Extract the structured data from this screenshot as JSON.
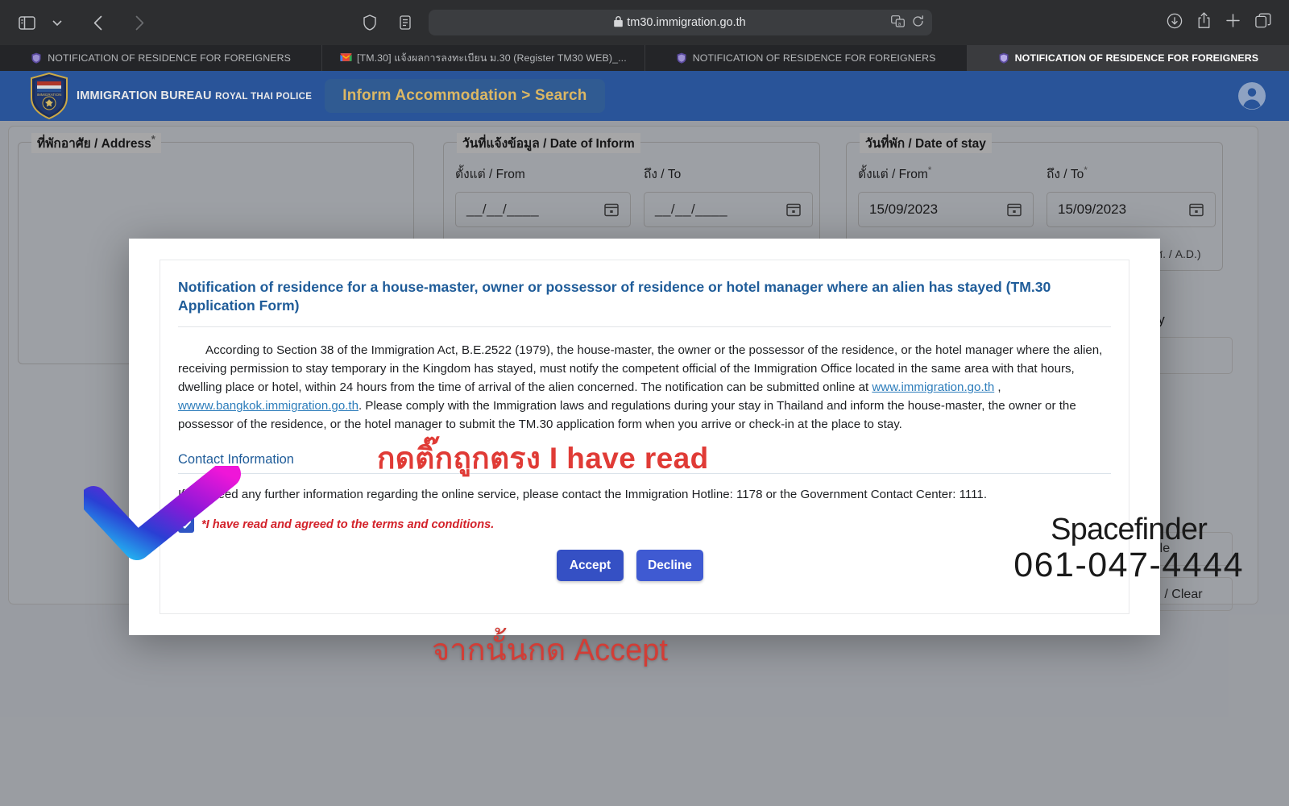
{
  "browser": {
    "url": "tm30.immigration.go.th",
    "icons": {
      "sidebar": "sidebar-icon",
      "sidebar_chevron": "chevron-down-icon",
      "back": "back-arrow-icon",
      "forward": "forward-arrow-icon",
      "shield": "shield-privacy-icon",
      "reader": "reader-view-icon",
      "lock": "lock-icon",
      "translate": "translate-icon",
      "reload": "reload-icon",
      "download": "download-icon",
      "share": "share-icon",
      "newtab": "plus-icon",
      "tabs": "tab-overview-icon"
    },
    "tabs": [
      {
        "title": "NOTIFICATION OF RESIDENCE FOR FOREIGNERS",
        "favicon": "immigration-shield-icon",
        "active": false
      },
      {
        "title": "[TM.30] แจ้งผลการลงทะเบียน ม.30 (Register TM30 WEB)_...",
        "favicon": "gmail-icon",
        "active": false
      },
      {
        "title": "NOTIFICATION OF RESIDENCE FOR FOREIGNERS",
        "favicon": "immigration-shield-icon",
        "active": false
      },
      {
        "title": "NOTIFICATION OF RESIDENCE FOR FOREIGNERS",
        "favicon": "immigration-shield-icon",
        "active": true
      }
    ]
  },
  "appbar": {
    "brand_line1": "IMMIGRATION BUREAU",
    "brand_line2": "ROYAL THAI POLICE",
    "nav_pill": "Inform Accommodation > Search",
    "accent_bg": "#2b5ba6",
    "pill_bg": "#33639f",
    "pill_text_color": "#f1c96b"
  },
  "form": {
    "address": {
      "legend": "ที่พักอาศัย / Address",
      "required": true
    },
    "date_of_inform": {
      "legend": "วันที่แจ้งข้อมูล / Date of Inform",
      "from_label": "ตั้งแต่ / From",
      "to_label": "ถึง / To",
      "from_value": "__/__/____",
      "to_value": "__/__/____"
    },
    "date_of_stay": {
      "legend": "วันที่พัก / Date of stay",
      "from_label": "ตั้งแต่ / From",
      "to_label": "ถึง / To",
      "from_value": "15/09/2023",
      "to_value": "15/09/2023",
      "from_required": true,
      "to_required": true,
      "hint": "ค.ศ. / A.D.)"
    },
    "nationality_label": "onality",
    "buttons": {
      "file": "e File",
      "clear": "้าจอ / Clear"
    }
  },
  "modal": {
    "title": "Notification of residence for a house-master, owner or possessor of residence or hotel manager where an alien has stayed (TM.30 Application Form)",
    "paragraph_1a": "According to Section 38 of the Immigration Act, B.E.2522 (1979), the house-master, the owner or the possessor of the residence, or the hotel manager where the alien, receiving permission to stay temporary in the Kingdom has stayed, must notify the competent official of the Immigration Office located in the same area with that hours, dwelling place or hotel, within 24 hours from the time of arrival of the alien concerned. The notification can be submitted online at ",
    "link_1": "www.immigration.go.th",
    "paragraph_1b": " , ",
    "link_2": "wwww.bangkok.immigration.go.th",
    "paragraph_1c": ". Please comply with the Immigration laws and regulations during your stay in Thailand and inform the house-master, the owner or the possessor of the residence, or the hotel manager to submit the TM.30 application form when you arrive or check-in at the place to stay.",
    "contact_heading": "Contact Information",
    "contact_text": "If you need any further information regarding the online service, please contact the Immigration Hotline: 1178 or the Government Contact Center: 1111.",
    "agree_label": "*I have read and agreed to the terms and conditions.",
    "agree_checked": true,
    "accept_label": "Accept",
    "decline_label": "Decline",
    "accent_color": "#3550c4",
    "title_color": "#1f5c99",
    "agree_color": "#d3222a"
  },
  "annotations": {
    "thai_tick": "กดติ๊กถูกตรง I have read",
    "thai_accept": "จากนั้นกด Accept",
    "checkmark_icon": "gradient-checkmark-icon",
    "annotation_color": "#e03b36"
  },
  "watermark": {
    "name": "Spacefinder",
    "phone": "061-047-4444"
  }
}
